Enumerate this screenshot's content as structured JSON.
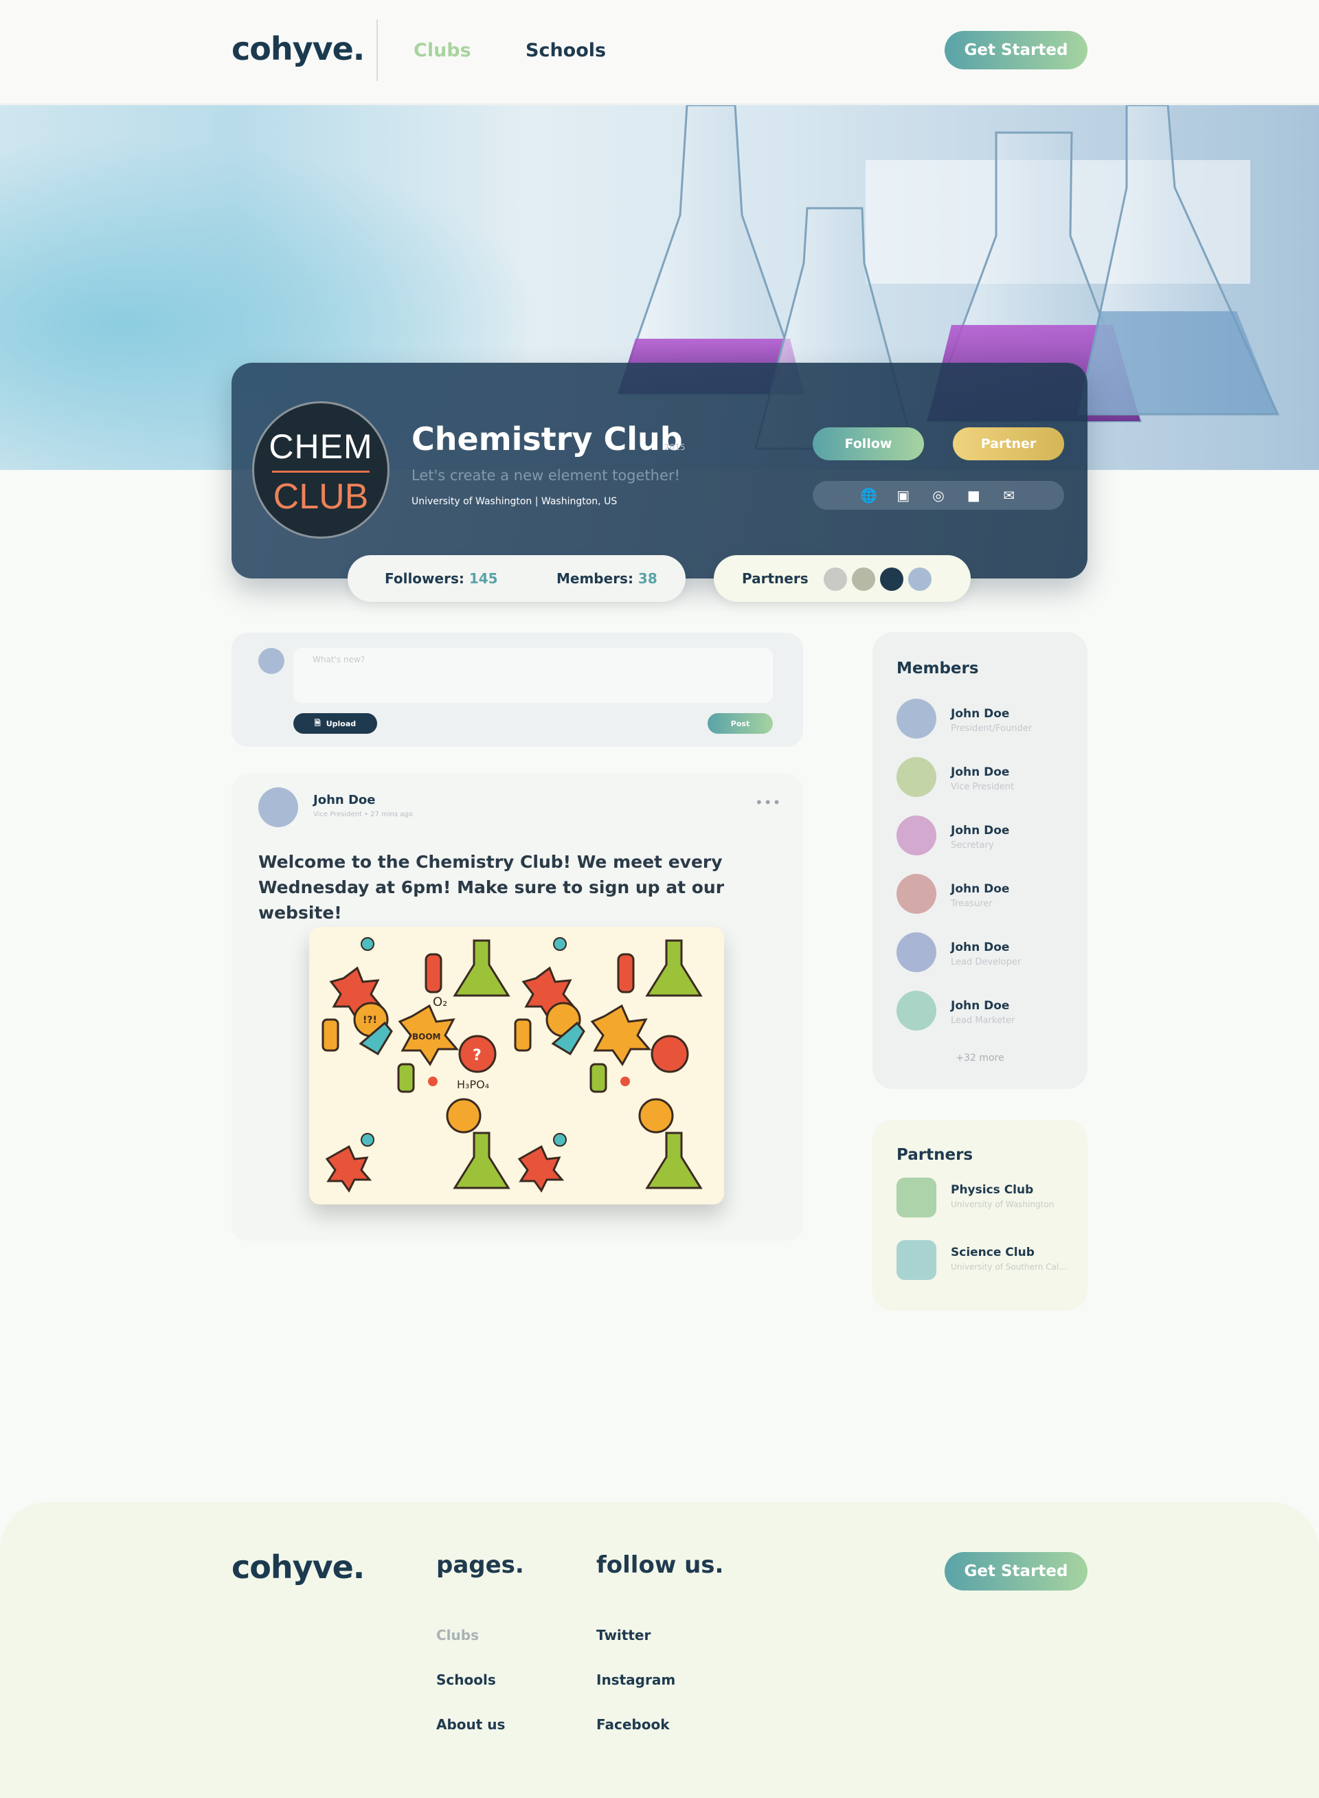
{
  "brand": {
    "logo": "cohyve."
  },
  "nav": {
    "links": [
      "Clubs",
      "Schools"
    ],
    "cta": "Get Started"
  },
  "club": {
    "logo_top": "CHEM",
    "logo_bottom": "CLUB",
    "name": "Chemistry Club",
    "year": "2015",
    "tagline": "Let's create a new element together!",
    "location": "University of Washington | Washington, US",
    "follow_label": "Follow",
    "partner_label": "Partner",
    "social_icons": [
      "globe-icon",
      "twitter-icon",
      "instagram-icon",
      "facebook-icon",
      "mail-icon"
    ]
  },
  "stats": {
    "followers_label": "Followers:",
    "followers_value": "145",
    "members_label": "Members:",
    "members_value": "38",
    "partners_label": "Partners",
    "partner_dot_colors": [
      "#c9c9c6",
      "#b5b9a6",
      "#1f3a4f",
      "#a9bbd4"
    ]
  },
  "composer": {
    "placeholder": "What's new?",
    "upload_label": "Upload",
    "post_label": "Post"
  },
  "post": {
    "author": "John Doe",
    "meta": "Vice President  •  27 mins ago",
    "more": "•••",
    "text": "Welcome to the Chemistry Club! We meet every Wednesday at 6pm! Make sure to sign up at our website!",
    "image_labels": [
      "O₂",
      "H₃PO₄",
      "BOOM",
      "!?!",
      "?"
    ]
  },
  "members": {
    "title": "Members",
    "items": [
      {
        "name": "John Doe",
        "role": "President/Founder",
        "color": "#a9bbd4"
      },
      {
        "name": "John Doe",
        "role": "Vice President",
        "color": "#c3d4a6"
      },
      {
        "name": "John Doe",
        "role": "Secretary",
        "color": "#d3a9cf"
      },
      {
        "name": "John Doe",
        "role": "Treasurer",
        "color": "#d3aaa8"
      },
      {
        "name": "John Doe",
        "role": "Lead Developer",
        "color": "#a9b5d4"
      },
      {
        "name": "John Doe",
        "role": "Lead Marketer",
        "color": "#a9d4c6"
      }
    ],
    "more": "+32 more"
  },
  "partners": {
    "title": "Partners",
    "items": [
      {
        "name": "Physics Club",
        "school": "University of Washington",
        "color": "#acd3a9"
      },
      {
        "name": "Science Club",
        "school": "University of Southern California",
        "color": "#a9d3d0"
      }
    ]
  },
  "footer": {
    "logo": "cohyve.",
    "pages_title": "pages.",
    "pages": [
      "Clubs",
      "Schools",
      "About us"
    ],
    "follow_title": "follow us.",
    "follow": [
      "Twitter",
      "Instagram",
      "Facebook"
    ],
    "cta": "Get Started"
  }
}
